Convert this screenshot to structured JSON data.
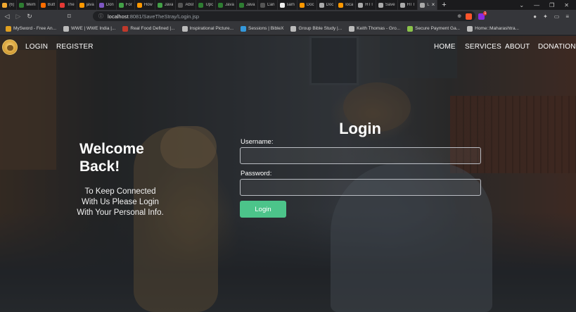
{
  "browser": {
    "tabs": [
      {
        "title": "(6)",
        "color": "#f0a830"
      },
      {
        "title": "Mem",
        "color": "#2e7d32"
      },
      {
        "title": "Butt",
        "color": "#ff6d00"
      },
      {
        "title": "The",
        "color": "#e53935"
      },
      {
        "title": "java",
        "color": "#ff9800"
      },
      {
        "title": "Don",
        "color": "#7e57c2"
      },
      {
        "title": "For",
        "color": "#43a047"
      },
      {
        "title": "How",
        "color": "#ff9800"
      },
      {
        "title": "Java",
        "color": "#43a047"
      },
      {
        "title": "Abst",
        "color": "#555555"
      },
      {
        "title": "Upc",
        "color": "#2e7d32"
      },
      {
        "title": "Java",
        "color": "#2e7d32"
      },
      {
        "title": "Java",
        "color": "#2e7d32"
      },
      {
        "title": "Can",
        "color": "#555555"
      },
      {
        "title": "sam",
        "color": "#eeeeee"
      },
      {
        "title": "Doc",
        "color": "#ff9800"
      },
      {
        "title": "Doc",
        "color": "#aaaaaa"
      },
      {
        "title": "loca",
        "color": "#ff9800"
      },
      {
        "title": "HTT",
        "color": "#aaaaaa"
      },
      {
        "title": "Save",
        "color": "#aaaaaa"
      },
      {
        "title": "HTT",
        "color": "#aaaaaa"
      },
      {
        "title": "L",
        "color": "#aaaaaa"
      }
    ],
    "new_tab_glyph": "+",
    "window_controls": [
      "⌄",
      "—",
      "❐",
      "✕"
    ],
    "nav": {
      "back": "◁",
      "forward": "▷",
      "reload": "↻",
      "bookmark": "⌑"
    },
    "address": {
      "info_icon": "ⓘ",
      "host": "localhost",
      "path": ":8081/SaveTheStray/Login.jsp",
      "zoom": "⊕",
      "share": "⇪"
    },
    "rewards_count": "1",
    "toolbar_right": [
      "●",
      "✦",
      "▭",
      "≡"
    ],
    "bookmarks": [
      {
        "label": "MySword - Free An...",
        "color": "#e0a020"
      },
      {
        "label": "WWE | WWE India |...",
        "color": "#bbbbbb"
      },
      {
        "label": "Real Food Defined |...",
        "color": "#c0392b"
      },
      {
        "label": "Inspirational Picture...",
        "color": "#bbbbbb"
      },
      {
        "label": "Sessions | BibleX",
        "color": "#3498db"
      },
      {
        "label": "Group Bible Study |...",
        "color": "#bbbbbb"
      },
      {
        "label": "Keith Thomas - Gro...",
        "color": "#bbbbbb"
      },
      {
        "label": "Secure Payment Ga...",
        "color": "#8bc34a"
      },
      {
        "label": "Home::Maharashtra...",
        "color": "#bbbbbb"
      }
    ]
  },
  "site": {
    "nav_left": [
      "LOGIN",
      "REGISTER"
    ],
    "nav_right": [
      "HOME",
      "SERVICES",
      "ABOUT",
      "DONATION"
    ],
    "welcome": {
      "title_line1": "Welcome",
      "title_line2": "Back!",
      "text": "To Keep Connected With Us Please Login With Your Personal Info."
    },
    "login": {
      "title": "Login",
      "username_label": "Username:",
      "password_label": "Password:",
      "username_value": "",
      "password_value": "",
      "button_label": "Login",
      "button_color": "#4cc48a"
    }
  }
}
